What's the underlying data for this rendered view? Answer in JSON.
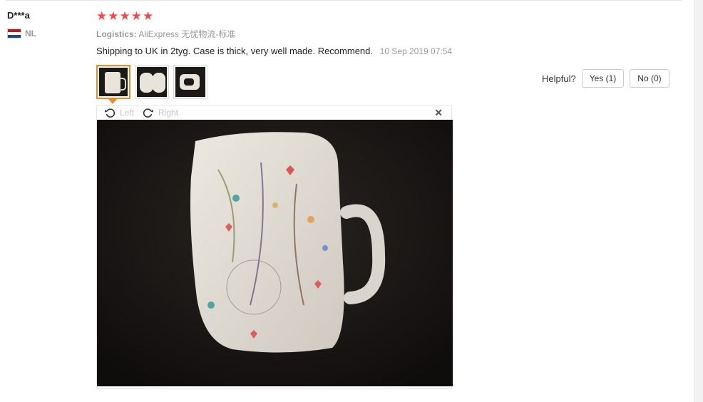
{
  "review": {
    "user": "D***a",
    "country": "NL",
    "stars": [
      "★",
      "★",
      "★",
      "★",
      "★"
    ],
    "logistics_label": "Logistics:",
    "logistics_value": "AliExpress 无忧物流-标准",
    "text": "Shipping to UK in 2tyg. Case is thick, very well made. Recommend.",
    "date": "10 Sep 2019 07:54"
  },
  "colors": {
    "star": "#ec4b4b",
    "active_border": "#f08a24",
    "flag": [
      "#ae1c28",
      "#ffffff",
      "#21468b"
    ]
  },
  "helpful": {
    "label": "Helpful?",
    "yes": "Yes (1)",
    "no": "No (0)"
  },
  "viewer": {
    "left": "Left",
    "right": "Right",
    "close": "✕"
  },
  "icons": [
    "rotate-left-icon",
    "rotate-right-icon",
    "close-icon",
    "flag-nl-icon",
    "star-icon"
  ]
}
